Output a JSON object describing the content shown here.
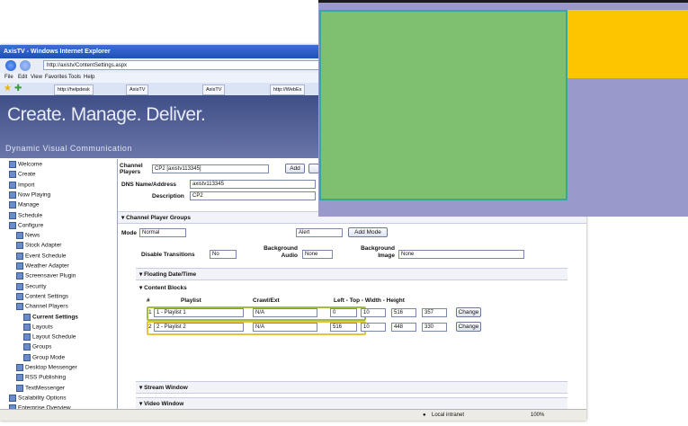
{
  "window": {
    "title": "AxisTV - Windows Internet Explorer",
    "address": "http://axistv/ContentSettings.aspx",
    "menu": [
      "File",
      "Edit",
      "View",
      "Favorites",
      "Tools",
      "Help"
    ],
    "tabs": [
      "http://helpdesk",
      "AxisTV",
      "AxisTV",
      "http://WebEx"
    ]
  },
  "banner": {
    "title": "Create. Manage. Deliver.",
    "subtitle": "Dynamic Visual Communication"
  },
  "sidebar": {
    "items": [
      "Welcome",
      "Create",
      "Import",
      "Now Playing",
      "Manage",
      "Schedule",
      "Configure",
      "News",
      "Stock Adapter",
      "Event Schedule",
      "Weather Adapter",
      "Screensaver Plugin",
      "Security",
      "Content Settings",
      "Channel Players",
      "Current Settings",
      "Layouts",
      "Layout Schedule",
      "Groups",
      "Group Mode",
      "Desktop Messenger",
      "RSS Publishing",
      "TextMessenger",
      "Scalability Options",
      "Enterprise Overview"
    ]
  },
  "main": {
    "channel_players_label": "Channel Players",
    "channel_players_value": "CP2 [axistv113345]",
    "add_label": "Add",
    "dns_label": "DNS Name/Address",
    "dns_value": "axistv113345",
    "description_label": "Description",
    "description_value": "CP2",
    "cp_groups_section": "Channel Player Groups",
    "mode_label": "Mode",
    "mode_value": "Normal",
    "alert_value": "Alert",
    "add_mode_label": "Add Mode",
    "disable_transitions_label": "Disable Transitions",
    "disable_transitions_value": "No",
    "bg_audio_label": "Background Audio",
    "bg_audio_value": "None",
    "bg_image_label": "Background Image",
    "bg_image_value": "None",
    "floating_section": "Floating Date/Time",
    "content_blocks_section": "Content Blocks",
    "columns": [
      "#",
      "Playlist",
      "Crawl/Ext",
      "Left - Top - Width - Height"
    ],
    "rows": [
      {
        "num": "1",
        "playlist": "1 - Playlist 1",
        "crawl": "N/A",
        "left": "0",
        "top": "10",
        "width": "516",
        "height": "357",
        "change": "Change"
      },
      {
        "num": "2",
        "playlist": "2 - Playlist 2",
        "crawl": "N/A",
        "left": "516",
        "top": "10",
        "width": "448",
        "height": "330",
        "change": "Change"
      }
    ],
    "stream_section": "Stream Window",
    "video_section": "Video Window"
  },
  "status": {
    "zone": "Local intranet",
    "zoom": "100%"
  },
  "colors": {
    "overlay_background": "#9999cc",
    "overlay_region_1": "#7ec070",
    "overlay_region_2": "#fcc500"
  }
}
